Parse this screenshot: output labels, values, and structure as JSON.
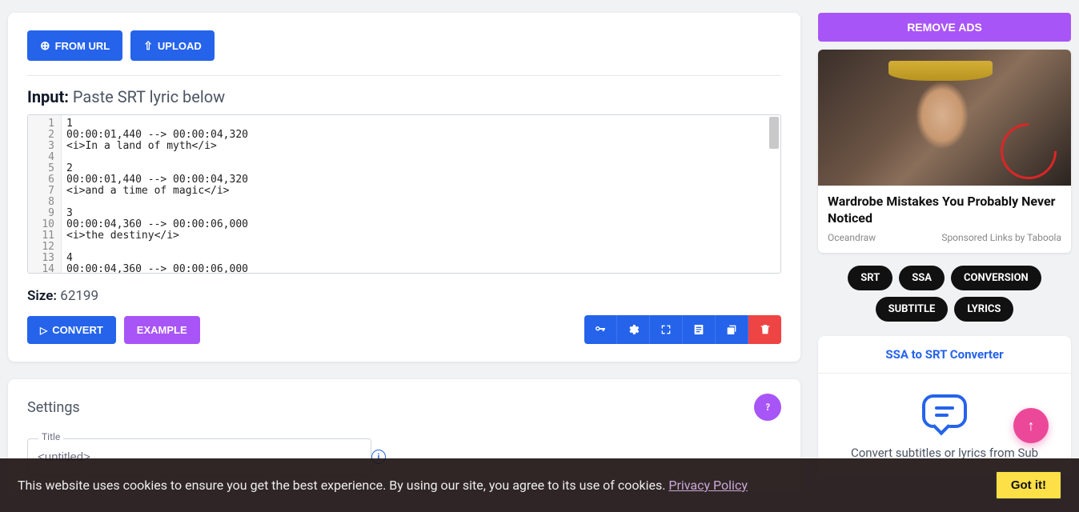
{
  "buttons": {
    "from_url": "FROM URL",
    "upload": "UPLOAD",
    "convert": "CONVERT",
    "example": "EXAMPLE",
    "remove_ads": "REMOVE ADS",
    "got_it": "Got it!"
  },
  "input": {
    "title_label": "Input:",
    "title_hint": "Paste SRT lyric below",
    "lines": [
      "1",
      "00:00:01,440 --> 00:00:04,320",
      "<i>In a land of myth</i>",
      "",
      "2",
      "00:00:01,440 --> 00:00:04,320",
      "<i>and a time of magic</i>",
      "",
      "3",
      "00:00:04,360 --> 00:00:06,000",
      "<i>the destiny</i>",
      "",
      "4",
      "00:00:04,360 --> 00:00:06,000"
    ]
  },
  "size": {
    "label": "Size:",
    "value": "62199"
  },
  "toolbar_icons": [
    "key-icon",
    "gear-icon",
    "expand-icon",
    "article-icon",
    "copy-icon",
    "trash-icon"
  ],
  "settings": {
    "title": "Settings",
    "title_field_label": "Title",
    "title_field_value": "<untitled>"
  },
  "ad": {
    "title": "Wardrobe Mistakes You Probably Never Noticed",
    "source": "Oceandraw",
    "sponsored": "Sponsored Links by Taboola"
  },
  "tags": [
    "SRT",
    "SSA",
    "CONVERSION",
    "SUBTITLE",
    "LYRICS"
  ],
  "converter": {
    "title": "SSA to SRT Converter",
    "desc": "Convert subtitles or lyrics from Sub"
  },
  "cookie": {
    "text": "This website uses cookies to ensure you get the best experience. By using our site, you agree to its use of cookies. ",
    "link": "Privacy Policy"
  }
}
